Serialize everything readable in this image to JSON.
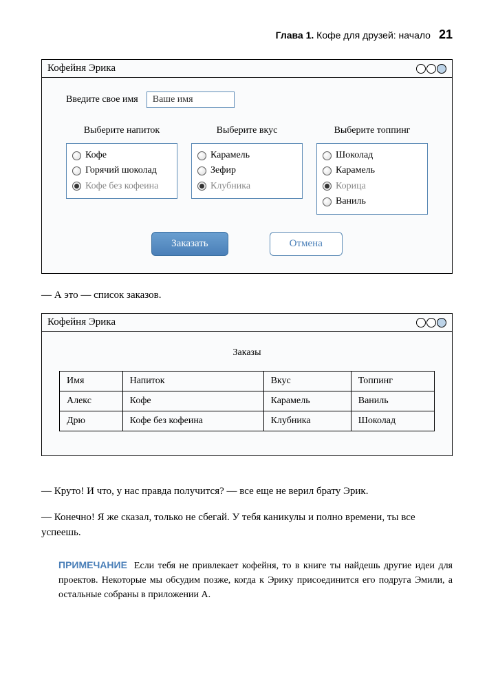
{
  "header": {
    "chapter_label": "Глава 1.",
    "chapter_title": "Кофе для друзей: начало",
    "page_number": "21"
  },
  "mockup1": {
    "title": "Кофейня Эрика",
    "name_label": "Введите свое имя",
    "name_placeholder": "Ваше имя",
    "col_drink": {
      "title": "Выберите напиток",
      "options": [
        "Кофе",
        "Горячий шоколад",
        "Кофе без кофеина"
      ],
      "selected": 2
    },
    "col_flavor": {
      "title": "Выберите вкус",
      "options": [
        "Карамель",
        "Зефир",
        "Клубника"
      ],
      "selected": 2
    },
    "col_topping": {
      "title": "Выберите топпинг",
      "options": [
        "Шоколад",
        "Карамель",
        "Корица",
        "Ваниль"
      ],
      "selected": 2
    },
    "order_btn": "Заказать",
    "cancel_btn": "Отмена"
  },
  "text1": "— А это — список заказов.",
  "mockup2": {
    "title": "Кофейня Эрика",
    "orders_heading": "Заказы",
    "headers": [
      "Имя",
      "Напиток",
      "Вкус",
      "Топпинг"
    ],
    "rows": [
      [
        "Алекс",
        "Кофе",
        "Карамель",
        "Ваниль"
      ],
      [
        "Дрю",
        "Кофе без кофеина",
        "Клубника",
        "Шоколад"
      ]
    ]
  },
  "text2": "— Круто! И что, у нас правда получится? — все еще не верил брату Эрик.",
  "text3": "— Конечно! Я же сказал, только не сбегай. У тебя каникулы и полно времени, ты все успеешь.",
  "note": {
    "label": "ПРИМЕЧАНИЕ",
    "text": "Если тебя не привлекает кофейня, то в книге ты найдешь другие идеи для проектов. Некоторые мы обсудим позже, когда к Эрику присоединится его подруга Эмили, а остальные собраны в приложении А."
  }
}
